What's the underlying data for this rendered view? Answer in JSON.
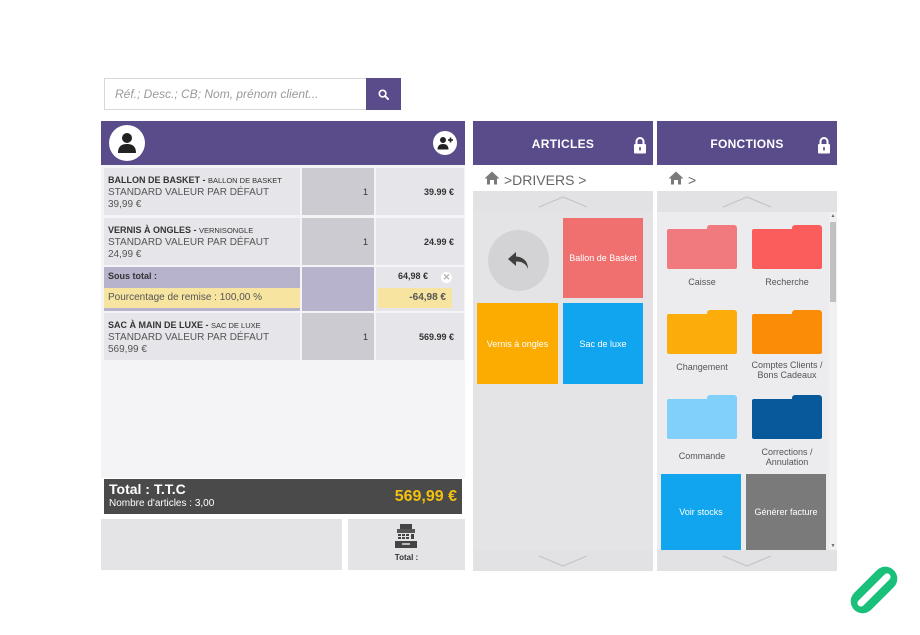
{
  "search": {
    "placeholder": "Réf.; Desc.; CB; Nom, prénom client...",
    "value": ""
  },
  "ticket": {
    "lines": [
      {
        "name": "BALLON DE BASKET",
        "sub": "BALLON DE BASKET",
        "variant": "STANDARD VALEUR PAR DÉFAUT 39,99 €",
        "qty": "1",
        "price": "39.99 €"
      },
      {
        "name": "VERNIS À ONGLES",
        "sub": "VERNISONGLE",
        "variant": "STANDARD VALEUR PAR DÉFAUT 24,99 €",
        "qty": "1",
        "price": "24.99 €"
      },
      {
        "name": "SAC À MAIN DE LUXE",
        "sub": "SAC DE LUXE",
        "variant": "STANDARD VALEUR PAR DÉFAUT 569,99 €",
        "qty": "1",
        "price": "569.99 €"
      }
    ],
    "subtotal": {
      "label": "Sous total :",
      "amount": "64,98 €",
      "remise_label": "Pourcentage de remise : 100,00 %",
      "remise_amount": "-64,98 €"
    },
    "name_separator": " - "
  },
  "total": {
    "label": "Total : T.T.C",
    "count_label": "Nombre d'articles : 3,00",
    "amount": "569,99 €"
  },
  "pay": {
    "label": "Total :"
  },
  "articles": {
    "title": "ARTICLES",
    "breadcrumb": ">DRIVERS >",
    "tiles": [
      {
        "label": "Ballon de Basket",
        "color": "#f07070"
      },
      {
        "label": "Vernis à ongles",
        "color": "#fcac00"
      },
      {
        "label": "Sac de luxe",
        "color": "#10a5ee"
      }
    ]
  },
  "fonctions": {
    "title": "FONCTIONS",
    "breadcrumb": ">",
    "folders": [
      {
        "label": "Caisse",
        "color": "#f07a7e"
      },
      {
        "label": "Recherche",
        "color": "#fb5d5d"
      },
      {
        "label": "Changement",
        "color": "#fcad0b"
      },
      {
        "label": "Comptes Clients / Bons Cadeaux",
        "color": "#fb8c05"
      },
      {
        "label": "Commande",
        "color": "#80d0fb"
      },
      {
        "label": "Corrections / Annulation",
        "color": "#08599b"
      }
    ],
    "tiles": [
      {
        "label": "Voir stocks",
        "color": "#10a5ee"
      },
      {
        "label": "Générer facture",
        "color": "#7a7a7a"
      }
    ]
  },
  "colors": {
    "brand": "#5a4b8a",
    "total_amount": "#f3c10e",
    "logo": "#18c07a"
  }
}
